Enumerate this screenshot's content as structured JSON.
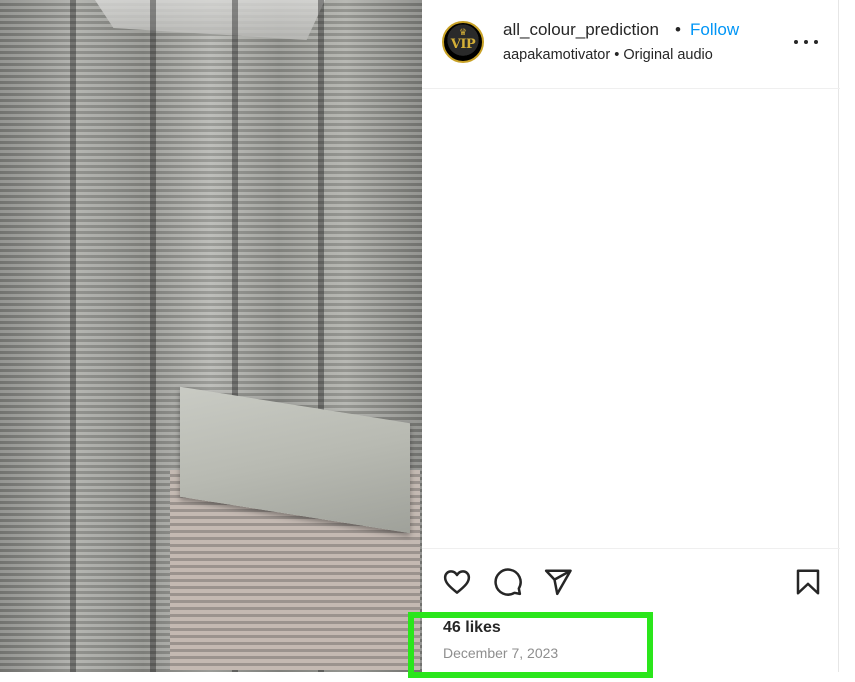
{
  "post": {
    "username": "all_colour_prediction",
    "separator": "•",
    "follow_label": "Follow",
    "audio_author": "aapakamotivator",
    "audio_separator": "•",
    "audio_label": "Original audio",
    "avatar_text": "VIP",
    "likes": "46 likes",
    "date": "December 7, 2023"
  },
  "colors": {
    "follow": "#0095f6",
    "highlight": "#2ae61b",
    "text": "#262626",
    "muted": "#8e8e8e"
  },
  "icons": [
    "more-options-icon",
    "heart-icon",
    "comment-icon",
    "share-icon",
    "bookmark-icon"
  ]
}
